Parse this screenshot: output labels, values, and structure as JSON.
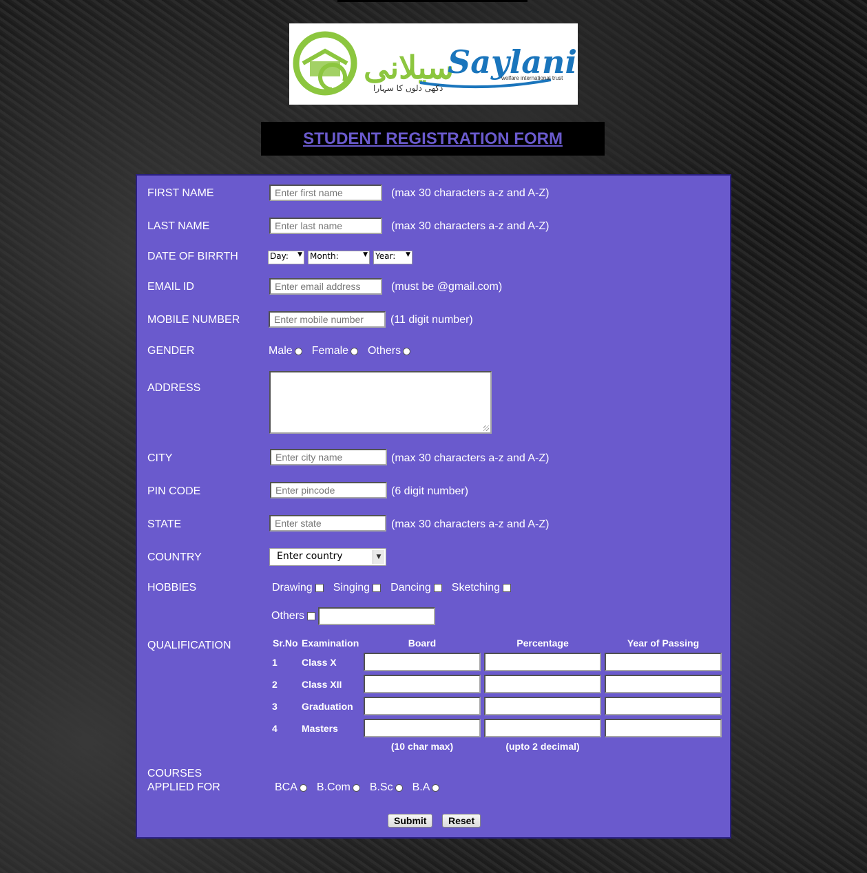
{
  "logo": {
    "brand": "Saylani",
    "urdu": "سیلانی",
    "tagline": "welfare international trust",
    "slogan": "دکھی دلوں کا سہارا"
  },
  "header": {
    "title": "STUDENT REGISTRATION FORM"
  },
  "form": {
    "first_name": {
      "label": "FIRST NAME",
      "placeholder": "Enter first name",
      "hint": "(max 30 characters a-z and A-Z)"
    },
    "last_name": {
      "label": "LAST NAME",
      "placeholder": "Enter last name",
      "hint": "(max 30 characters a-z and A-Z)"
    },
    "dob": {
      "label": "DATE OF BIRRTH",
      "day": "Day:",
      "month": "Month:",
      "year": "Year:"
    },
    "email": {
      "label": "EMAIL ID",
      "placeholder": "Enter email address",
      "hint": "(must be @gmail.com)"
    },
    "mobile": {
      "label": "MOBILE NUMBER",
      "placeholder": "Enter mobile number",
      "hint": "(11 digit number)"
    },
    "gender": {
      "label": "GENDER",
      "options": [
        "Male",
        "Female",
        "Others"
      ]
    },
    "address": {
      "label": "ADDRESS"
    },
    "city": {
      "label": "CITY",
      "placeholder": "Enter city name",
      "hint": "(max 30 characters a-z and A-Z)"
    },
    "pincode": {
      "label": "PIN CODE",
      "placeholder": "Enter pincode",
      "hint": "(6 digit number)"
    },
    "state": {
      "label": "STATE",
      "placeholder": "Enter state",
      "hint": "(max 30 characters a-z and A-Z)"
    },
    "country": {
      "label": "COUNTRY",
      "selected": "Enter country"
    },
    "hobbies": {
      "label": "HOBBIES",
      "options": [
        "Drawing",
        "Singing",
        "Dancing",
        "Sketching"
      ],
      "others": "Others"
    },
    "qualification": {
      "label": "QUALIFICATION",
      "headers": [
        "Sr.No",
        "Examination",
        "Board",
        "Percentage",
        "Year of Passing"
      ],
      "rows": [
        {
          "sr": "1",
          "exam": "Class X"
        },
        {
          "sr": "2",
          "exam": "Class XII"
        },
        {
          "sr": "3",
          "exam": "Graduation"
        },
        {
          "sr": "4",
          "exam": "Masters"
        }
      ],
      "board_note": "(10 char max)",
      "percent_note": "(upto 2 decimal)"
    },
    "courses": {
      "label_line1": "COURSES",
      "label_line2": "APPLIED FOR",
      "options": [
        "BCA",
        "B.Com",
        "B.Sc",
        "B.A"
      ]
    },
    "buttons": {
      "submit": "Submit",
      "reset": "Reset"
    }
  }
}
